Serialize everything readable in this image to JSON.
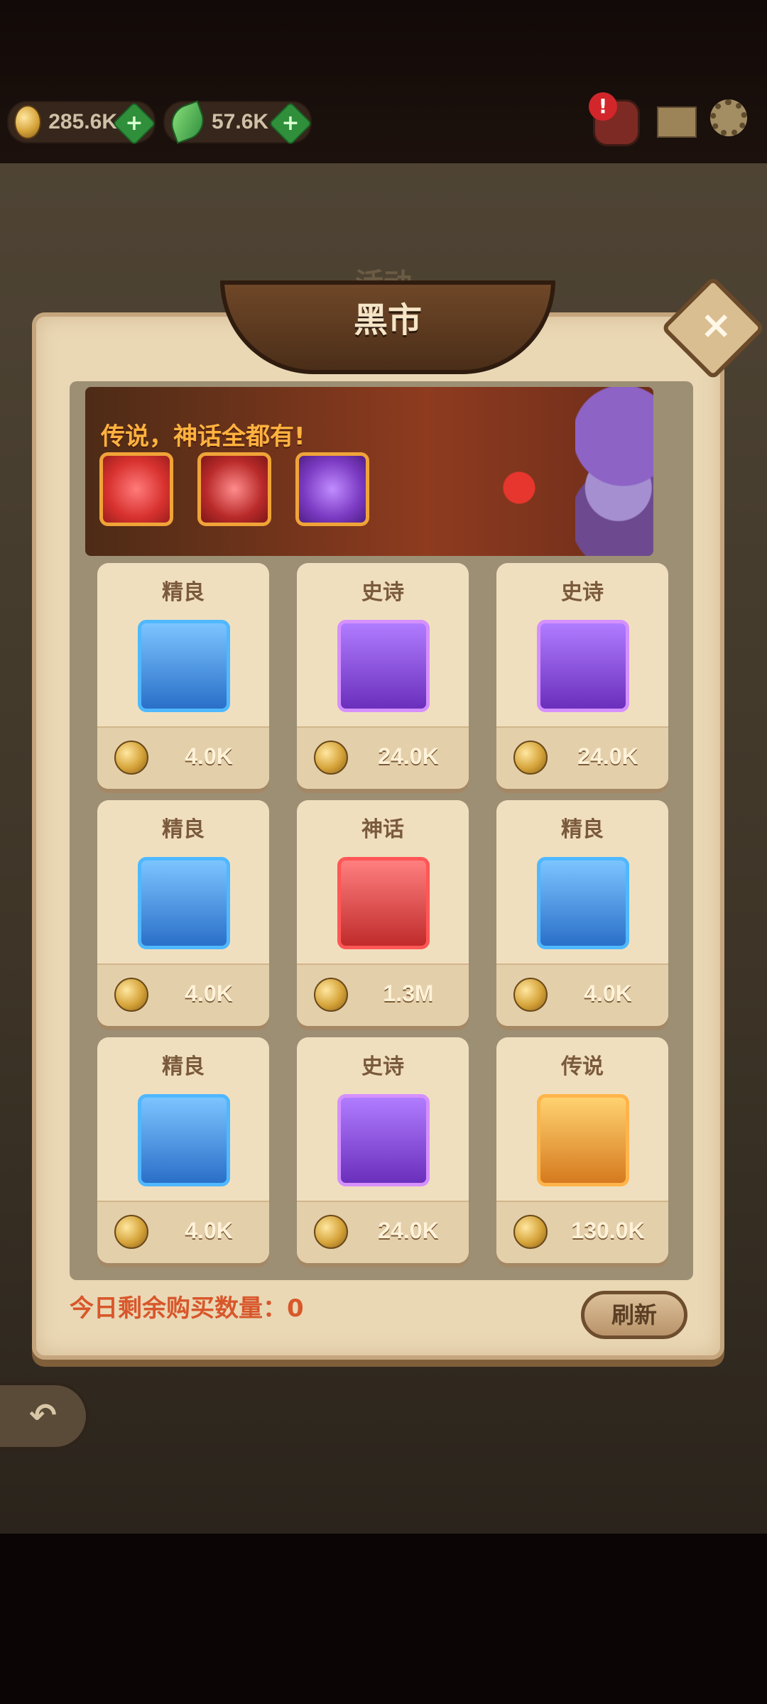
{
  "top": {
    "gold": "285.6K",
    "leaf": "57.6K",
    "alert_badge": "!"
  },
  "event_tab": "活动",
  "title": "黑市",
  "close_icon": "×",
  "banner": {
    "text": "传说，神话全都有!"
  },
  "items": [
    {
      "rarity": "精良",
      "price": "4.0K",
      "icon": "amulet-icon",
      "tier": "rare"
    },
    {
      "rarity": "史诗",
      "price": "24.0K",
      "icon": "dagger-icon",
      "tier": "epic"
    },
    {
      "rarity": "史诗",
      "price": "24.0K",
      "icon": "helmet-icon",
      "tier": "epic"
    },
    {
      "rarity": "精良",
      "price": "4.0K",
      "icon": "cloak-icon",
      "tier": "rare"
    },
    {
      "rarity": "神话",
      "price": "1.3M",
      "icon": "gauntlet-icon",
      "tier": "myth"
    },
    {
      "rarity": "精良",
      "price": "4.0K",
      "icon": "orb-icon",
      "tier": "rare"
    },
    {
      "rarity": "精良",
      "price": "4.0K",
      "icon": "ring-icon",
      "tier": "rare"
    },
    {
      "rarity": "史诗",
      "price": "24.0K",
      "icon": "curved-dagger-icon",
      "tier": "epic"
    },
    {
      "rarity": "传说",
      "price": "130.0K",
      "icon": "shield-icon",
      "tier": "legend"
    }
  ],
  "remaining_label": "今日剩余购买数量：0",
  "refresh_button": "刷新"
}
